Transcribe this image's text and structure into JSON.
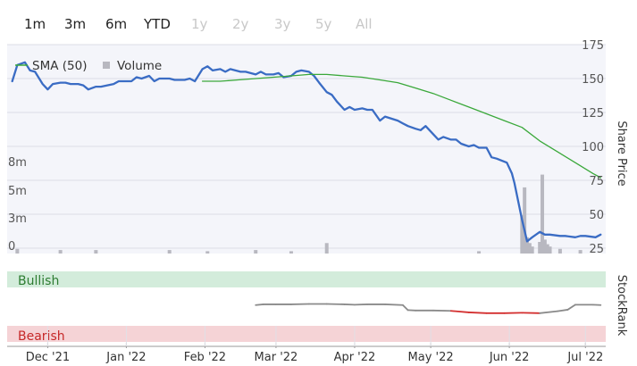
{
  "range_selector": {
    "buttons": [
      {
        "label": "1m",
        "enabled": true
      },
      {
        "label": "3m",
        "enabled": true
      },
      {
        "label": "6m",
        "enabled": true
      },
      {
        "label": "YTD",
        "enabled": true
      },
      {
        "label": "1y",
        "enabled": false
      },
      {
        "label": "2y",
        "enabled": false
      },
      {
        "label": "3y",
        "enabled": false
      },
      {
        "label": "5y",
        "enabled": false
      },
      {
        "label": "All",
        "enabled": false
      }
    ]
  },
  "colors": {
    "price_line": "#3a6cc4",
    "sma_line": "#3aa83a",
    "volume_bar": "#b8b8c0",
    "plot_bg": "#f4f5fa",
    "bullish_bg": "#d3ecdb",
    "bullish_text": "#2e7d32",
    "bearish_bg": "#f5d3d6",
    "bearish_text": "#c62828",
    "rank_line_neutral": "#8a8a8a",
    "rank_line_bearish": "#d32f2f"
  },
  "chart_data": [
    {
      "type": "line",
      "ylabel": "Share Price",
      "ylim": [
        22,
        175
      ],
      "y_ticks": [
        175,
        150,
        125,
        100,
        75,
        50,
        25
      ],
      "volume_ticks": [
        "8m",
        "5m",
        "3m",
        "0"
      ],
      "x_tick_labels": [
        "Dec '21",
        "Jan '22",
        "Feb '22",
        "Mar '22",
        "Apr '22",
        "May '22",
        "Jun '22",
        "Jul '22"
      ],
      "legend": [
        {
          "name": "SMA (50)",
          "symbol": "line"
        },
        {
          "name": "Volume",
          "symbol": "square"
        }
      ],
      "legend_position": "top-left",
      "grid": true,
      "series": [
        {
          "name": "",
          "x": [
            "2021-11-17",
            "2021-11-19",
            "2021-11-22",
            "2021-11-24",
            "2021-11-26",
            "2021-11-29",
            "2021-12-01",
            "2021-12-03",
            "2021-12-06",
            "2021-12-08",
            "2021-12-10",
            "2021-12-13",
            "2021-12-15",
            "2021-12-17",
            "2021-12-20",
            "2021-12-22",
            "2021-12-27",
            "2021-12-29",
            "2022-01-03",
            "2022-01-05",
            "2022-01-07",
            "2022-01-10",
            "2022-01-12",
            "2022-01-14",
            "2022-01-18",
            "2022-01-20",
            "2022-01-24",
            "2022-01-26",
            "2022-01-28",
            "2022-01-31",
            "2022-02-02",
            "2022-02-04",
            "2022-02-07",
            "2022-02-09",
            "2022-02-11",
            "2022-02-15",
            "2022-02-17",
            "2022-02-21",
            "2022-02-23",
            "2022-02-25",
            "2022-02-28",
            "2022-03-02",
            "2022-03-04",
            "2022-03-07",
            "2022-03-09",
            "2022-03-11",
            "2022-03-14",
            "2022-03-16",
            "2022-03-18",
            "2022-03-21",
            "2022-03-23",
            "2022-03-25",
            "2022-03-28",
            "2022-03-30",
            "2022-04-01",
            "2022-04-04",
            "2022-04-06",
            "2022-04-08",
            "2022-04-11",
            "2022-04-13",
            "2022-04-18",
            "2022-04-20",
            "2022-04-22",
            "2022-04-25",
            "2022-04-27",
            "2022-04-29",
            "2022-05-02",
            "2022-05-04",
            "2022-05-06",
            "2022-05-09",
            "2022-05-11",
            "2022-05-13",
            "2022-05-16",
            "2022-05-18",
            "2022-05-20",
            "2022-05-23",
            "2022-05-25",
            "2022-05-27",
            "2022-05-31",
            "2022-06-02",
            "2022-06-03",
            "2022-06-06",
            "2022-06-08",
            "2022-06-10",
            "2022-06-13",
            "2022-06-15",
            "2022-06-17",
            "2022-06-21",
            "2022-06-23",
            "2022-06-27",
            "2022-06-29",
            "2022-07-01",
            "2022-07-05",
            "2022-07-07"
          ],
          "values": [
            148,
            160,
            162,
            156,
            155,
            146,
            142,
            146,
            147,
            147,
            146,
            146,
            145,
            142,
            144,
            144,
            146,
            148,
            148,
            151,
            150,
            152,
            148,
            150,
            150,
            149,
            149,
            150,
            148,
            157,
            159,
            156,
            157,
            155,
            157,
            155,
            155,
            153,
            155,
            153,
            153,
            154,
            151,
            152,
            155,
            156,
            155,
            152,
            147,
            140,
            138,
            133,
            127,
            129,
            127,
            128,
            127,
            127,
            119,
            122,
            119,
            117,
            115,
            113,
            112,
            115,
            109,
            105,
            107,
            105,
            105,
            102,
            100,
            101,
            99,
            99,
            92,
            91,
            88,
            80,
            73,
            46,
            30,
            33,
            37,
            35,
            35,
            34,
            34,
            33,
            34,
            34,
            33,
            35
          ]
        },
        {
          "name": "SMA (50)",
          "x": [
            "2022-01-31",
            "2022-02-07",
            "2022-02-14",
            "2022-02-21",
            "2022-02-28",
            "2022-03-07",
            "2022-03-14",
            "2022-03-21",
            "2022-03-28",
            "2022-04-04",
            "2022-04-11",
            "2022-04-18",
            "2022-04-25",
            "2022-05-02",
            "2022-05-09",
            "2022-05-16",
            "2022-05-23",
            "2022-05-30",
            "2022-06-06",
            "2022-06-13",
            "2022-06-20",
            "2022-06-27",
            "2022-07-04",
            "2022-07-07"
          ],
          "values": [
            148,
            148,
            149,
            150,
            151,
            152,
            153,
            153,
            152,
            151,
            149,
            147,
            143,
            139,
            134,
            129,
            124,
            119,
            114,
            104,
            96,
            88,
            80,
            77
          ]
        }
      ],
      "volume": {
        "x": [
          "2021-11-19",
          "2021-12-06",
          "2021-12-20",
          "2022-01-18",
          "2022-02-02",
          "2022-02-21",
          "2022-03-07",
          "2022-03-21",
          "2022-05-20",
          "2022-06-06",
          "2022-06-07",
          "2022-06-08",
          "2022-06-09",
          "2022-06-10",
          "2022-06-13",
          "2022-06-14",
          "2022-06-15",
          "2022-06-16",
          "2022-06-17",
          "2022-06-21",
          "2022-06-29"
        ],
        "values_m": [
          0.4,
          0.3,
          0.3,
          0.3,
          0.2,
          0.3,
          0.2,
          0.9,
          0.2,
          3.3,
          5.7,
          1.4,
          0.9,
          0.6,
          1.0,
          6.8,
          1.2,
          0.8,
          0.6,
          0.4,
          0.3
        ]
      }
    },
    {
      "type": "line",
      "ylabel": "StockRank",
      "bands": [
        "Bullish",
        "Bearish"
      ],
      "ylim": [
        0,
        100
      ],
      "series": [
        {
          "name": "",
          "x": [
            "2022-02-21",
            "2022-02-24",
            "2022-03-01",
            "2022-03-07",
            "2022-03-14",
            "2022-03-21",
            "2022-03-28",
            "2022-04-01",
            "2022-04-06",
            "2022-04-13",
            "2022-04-20",
            "2022-04-22",
            "2022-04-25",
            "2022-05-02",
            "2022-05-09",
            "2022-05-16",
            "2022-05-23",
            "2022-05-30",
            "2022-06-06",
            "2022-06-13",
            "2022-06-20",
            "2022-06-24",
            "2022-06-27",
            "2022-07-04",
            "2022-07-07"
          ],
          "values": [
            54,
            56,
            56,
            56,
            57,
            57,
            56,
            55,
            56,
            56,
            54,
            41,
            40,
            40,
            39,
            35,
            33,
            33,
            34,
            33,
            38,
            42,
            55,
            55,
            54
          ]
        }
      ],
      "bearish_range": [
        "2022-05-09",
        "2022-06-13"
      ]
    }
  ]
}
